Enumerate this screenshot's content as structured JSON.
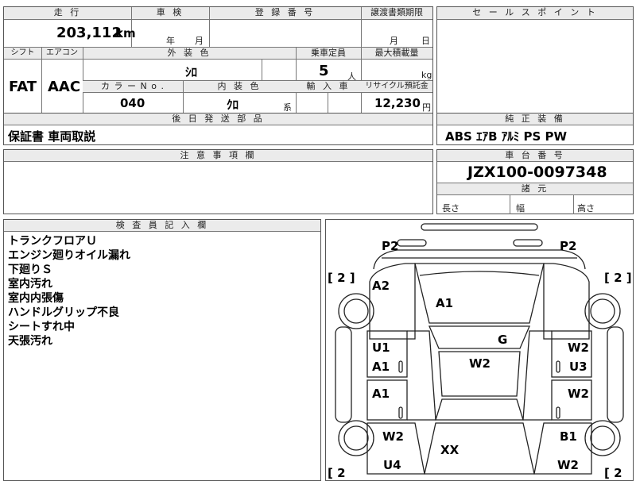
{
  "header": {
    "mileage_label": "走 行",
    "inspection_label": "車 検",
    "registration_label": "登 録 番 号",
    "transfer_doc_label": "譲渡書類期限",
    "sales_point_label": "セ ー ル ス ポ イ ン ト",
    "mileage_value": "203,112",
    "mileage_unit": "km",
    "year_unit": "年",
    "month_unit": "月",
    "transfer_month_unit": "月",
    "transfer_day_unit": "日"
  },
  "row2": {
    "shift_label": "シフト",
    "aircon_label": "エアコン",
    "exterior_color_label": "外 装 色",
    "capacity_label": "乗車定員",
    "max_load_label": "最大積載量",
    "shift_value": "FAT",
    "aircon_value": "AAC",
    "exterior_color_value": "ｼﾛ",
    "capacity_value": "5",
    "capacity_unit": "人",
    "max_load_unit": "kg",
    "color_no_label": "カ ラ ー  N o .",
    "interior_color_label": "内 装 色",
    "import_label": "輸 入 車",
    "recycle_label": "リサイクル預託金",
    "color_no_value": "040",
    "interior_color_value": "ｸﾛ",
    "interior_suffix": "系",
    "recycle_value": "12,230",
    "recycle_unit": "円"
  },
  "shipping": {
    "label": "後 日 発 送 部 品",
    "value": "保証書 車両取説"
  },
  "equipment": {
    "label": "純 正 装 備",
    "value": "ABS ｴｱB ｱﾙﾐ PS PW"
  },
  "caution": {
    "label": "注 意 事 項 欄"
  },
  "chassis": {
    "label": "車 台 番 号",
    "value": "JZX100-0097348",
    "dims_label": "諸 元",
    "length_label": "長さ",
    "width_label": "幅",
    "height_label": "高さ"
  },
  "inspector": {
    "label": "検 査 員 記 入 欄",
    "notes": [
      "トランクフロアＵ",
      "エンジン廻りオイル漏れ",
      "下廻りＳ",
      "室内汚れ",
      "室内内張傷",
      "ハンドルグリップ不良",
      "シートすれ中",
      "天張汚れ"
    ]
  },
  "diagram": {
    "p2_left": "P2",
    "p2_right": "P2",
    "a2": "A2",
    "a1_top": "A1",
    "g": "G",
    "u1": "U1",
    "a1_left1": "A1",
    "w2_center": "W2",
    "w2_right1": "W2",
    "u3_right": "U3",
    "a1_left2": "A1",
    "w2_right2": "W2",
    "w2_left_wheel": "W2",
    "b1_right_wheel": "B1",
    "xx": "XX",
    "u4": "U4",
    "w2_bottom_right": "W2",
    "bracket_left_top": "[ 2 ]",
    "bracket_right_top": "[ 2 ]",
    "bracket_left_bottom": "[ 2",
    "bracket_right_bottom": "[ 2"
  }
}
